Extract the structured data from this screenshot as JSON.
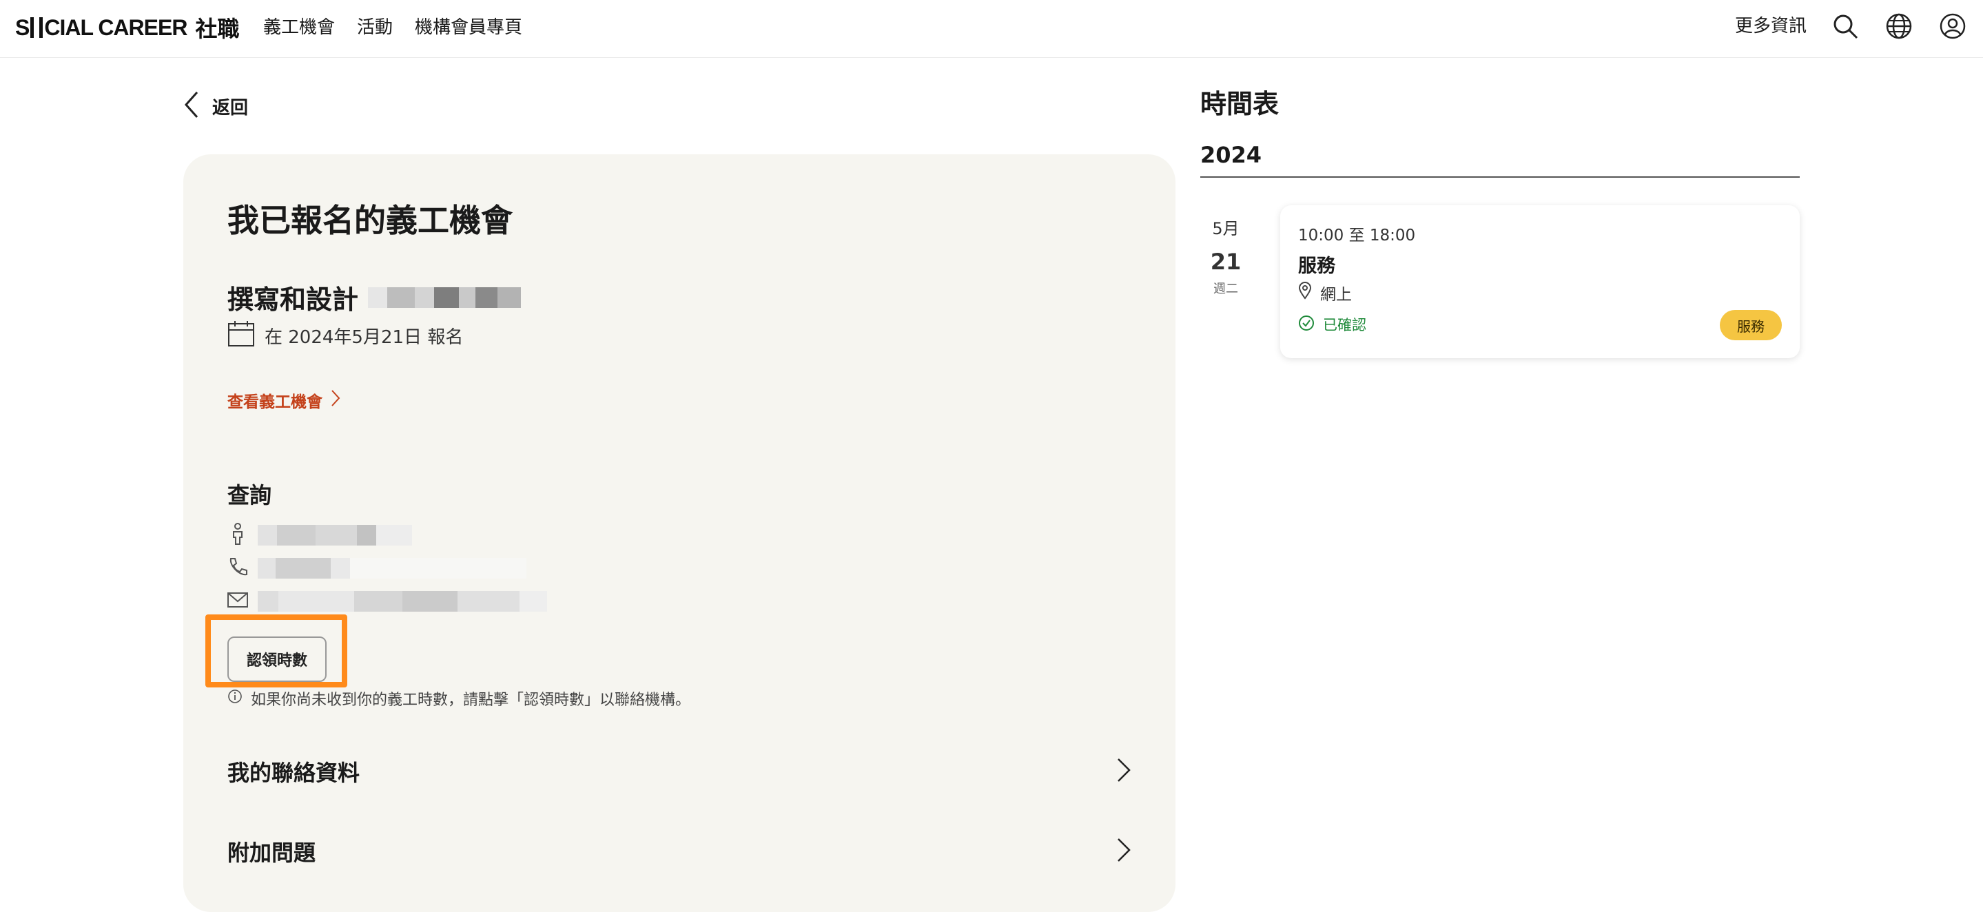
{
  "header": {
    "logo": {
      "latin_prefix": "S",
      "latin_suffix": "CIAL CAREER",
      "chinese": "社職"
    },
    "nav": [
      "義工機會",
      "活動",
      "機構會員專頁"
    ],
    "more_info": "更多資訊",
    "icons": [
      "search-icon",
      "globe-icon",
      "user-icon"
    ]
  },
  "back": {
    "label": "返回"
  },
  "card": {
    "title": "我已報名的義工機會",
    "opportunity_title": "撰寫和設計",
    "registration": "在 2024年5月21日 報名",
    "view_link": "查看義工機會",
    "inquiry_title": "查詢",
    "claim_button": "認領時數",
    "info_note": "如果你尚未收到你的義工時數，請點擊「認領時數」以聯絡機構。",
    "sections": [
      "我的聯絡資料",
      "附加問題"
    ]
  },
  "schedule": {
    "title": "時間表",
    "year": "2024",
    "date": {
      "month": "5月",
      "day": "21",
      "weekday": "週二"
    },
    "event": {
      "time": "10:00 至 18:00",
      "title": "服務",
      "location": "網上",
      "status": "已確認",
      "tag": "服務"
    }
  },
  "colors": {
    "accent_link": "#c4411a",
    "highlight": "#ff8a1a",
    "tag": "#f5c542",
    "confirmed": "#1f8a3a",
    "card_bg": "#f6f5f0"
  }
}
